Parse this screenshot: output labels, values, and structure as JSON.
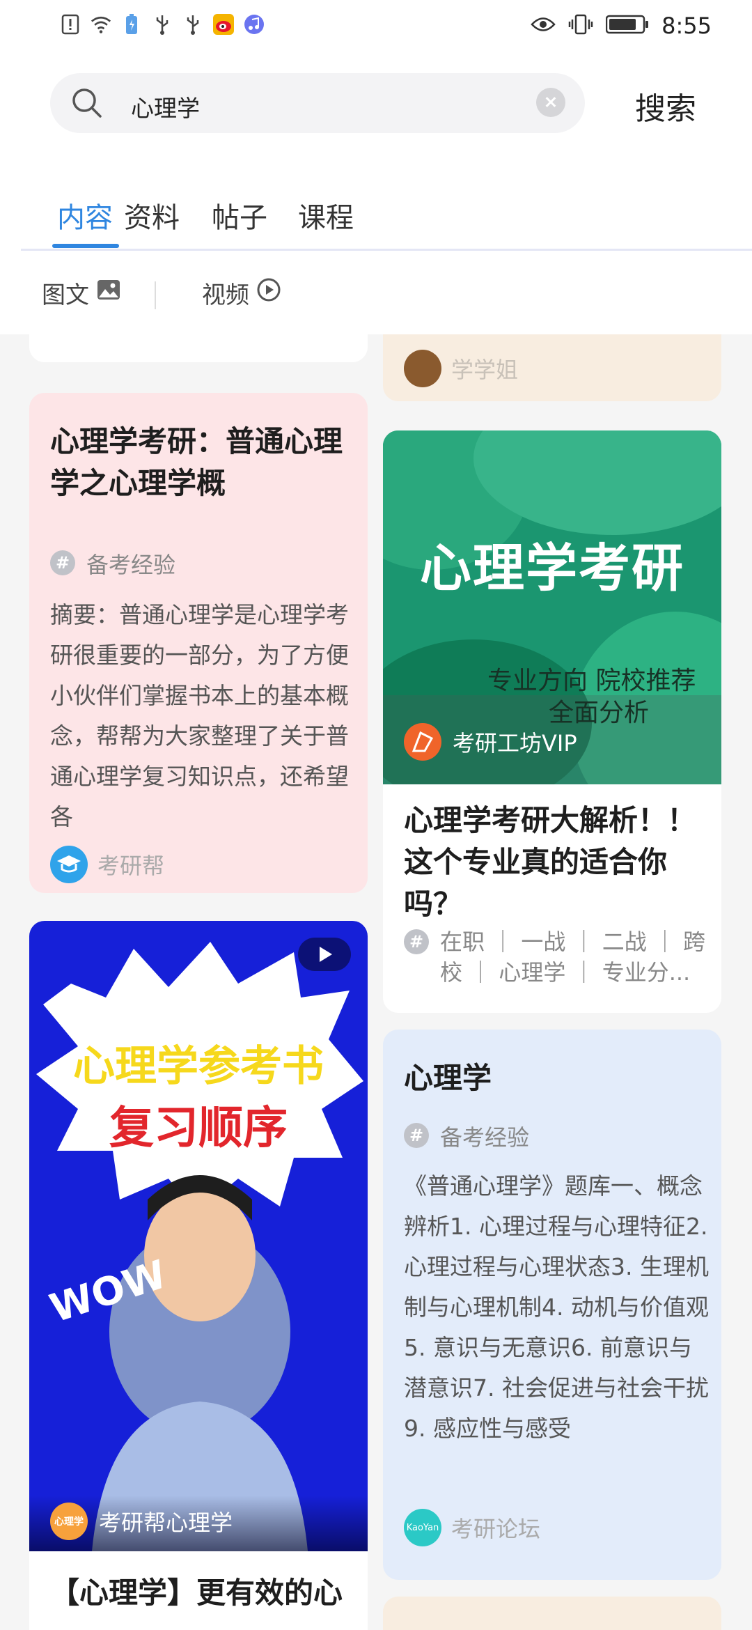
{
  "status_bar": {
    "time": "8:55",
    "icons_left": [
      "alert-icon",
      "wifi-icon",
      "battery-saver-icon",
      "usb-icon",
      "usb-icon",
      "weibo-icon",
      "music-icon"
    ],
    "icons_right": [
      "eye-icon",
      "vibrate-icon",
      "battery-icon"
    ]
  },
  "search": {
    "query": "心理学",
    "submit_label": "搜索"
  },
  "tabs": [
    {
      "label": "内容",
      "active": true
    },
    {
      "label": "资料",
      "active": false
    },
    {
      "label": "帖子",
      "active": false
    },
    {
      "label": "课程",
      "active": false
    }
  ],
  "filters": [
    {
      "label": "图文",
      "icon": "image-icon"
    },
    {
      "label": "视频",
      "icon": "play-circle-icon"
    }
  ],
  "feed": {
    "top_right_partial_author": "学学姐",
    "card_psych1": {
      "title": "心理学考研：普通心理学之心理学概",
      "tag": "备考经验",
      "abstract": "摘要：普通心理学是心理学考研很重要的一部分，为了方便小伙伴们掌握书本上的基本概念，帮帮为大家整理了关于普通心理学复习知识点，还希望各",
      "author": "考研帮"
    },
    "card_ad": {
      "thumb_heading": "心理学考研",
      "thumb_sub1": "专业方向 院校推荐",
      "thumb_sub2": "全面分析",
      "thumb_author": "考研工坊VIP",
      "title": "心理学考研大解析！！这个专业真的适合你吗？",
      "tags": "在职 ｜ 一战 ｜ 二战 ｜ 跨校 ｜ 心理学 ｜ 专业分..."
    },
    "card_video": {
      "thumb_line1": "心理学参考书",
      "thumb_line2": "复习顺序",
      "thumb_wow": "WOW",
      "thumb_badge": "心理学",
      "thumb_author": "考研帮心理学",
      "title": "【心理学】更有效的心"
    },
    "card_psych2": {
      "title": "心理学",
      "tag": "备考经验",
      "abstract": "《普通心理学》题库一、概念辨析1. 心理过程与心理特征2. 心理过程与心理状态3. 生理机制与心理机制4. 动机与价值观5. 意识与无意识6. 前意识与潜意识7. 社会促进与社会干扰9. 感应性与感受",
      "author": "考研论坛",
      "avatar_text": "KaoYan"
    }
  },
  "colors": {
    "accent": "#2f86e0",
    "card_pink": "#fde5e7",
    "card_blue": "#e3ecfa",
    "card_beige": "#f8ede0",
    "ad_green": "#1b9670",
    "video_blue": "#1620d8"
  }
}
